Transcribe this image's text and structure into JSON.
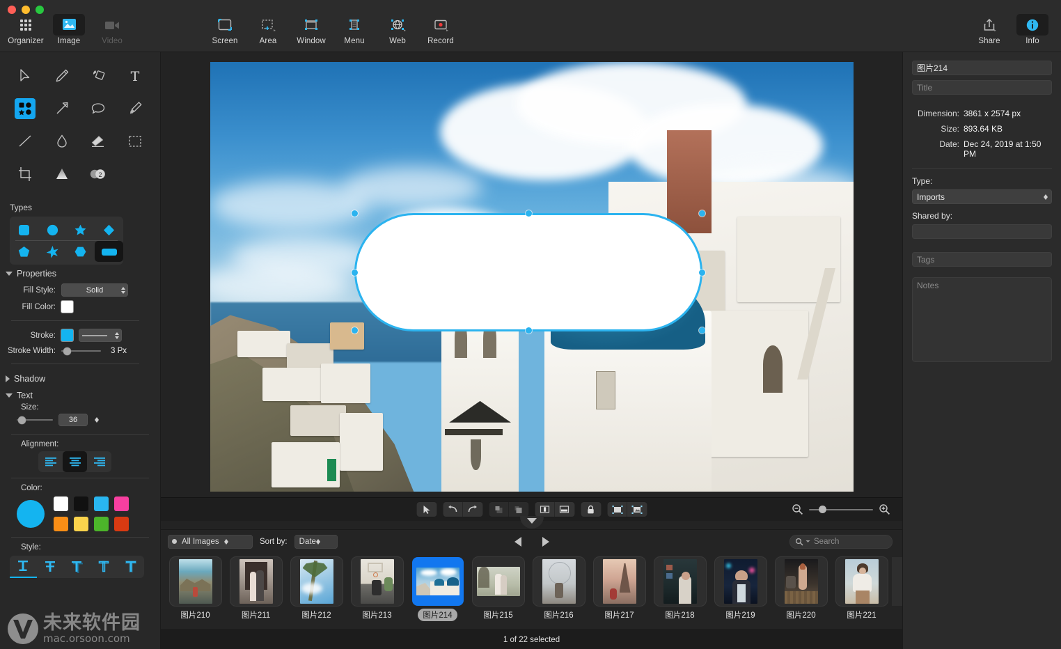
{
  "window": {
    "traffic_lights": [
      "close",
      "minimize",
      "zoom"
    ]
  },
  "toolbar": {
    "left_items": [
      {
        "label": "Organizer",
        "icon": "grid-icon",
        "active": false
      },
      {
        "label": "Image",
        "icon": "image-icon",
        "active": true
      },
      {
        "label": "Video",
        "icon": "video-icon",
        "active": false,
        "disabled": true
      }
    ],
    "capture_items": [
      {
        "label": "Screen",
        "icon": "screen-capture-icon"
      },
      {
        "label": "Area",
        "icon": "area-capture-icon"
      },
      {
        "label": "Window",
        "icon": "window-capture-icon"
      },
      {
        "label": "Menu",
        "icon": "menu-capture-icon"
      },
      {
        "label": "Web",
        "icon": "web-capture-icon"
      },
      {
        "label": "Record",
        "icon": "record-icon"
      }
    ],
    "right_items": [
      {
        "label": "Share",
        "icon": "share-icon",
        "active": false
      },
      {
        "label": "Info",
        "icon": "info-icon",
        "active": true
      }
    ]
  },
  "tools": {
    "rows": [
      [
        "select-arrow-icon",
        "pencil-icon",
        "shapes-fill-icon",
        "text-tool-icon"
      ],
      [
        "shapes-tool-icon",
        "arrow-tool-icon",
        "callout-bubble-icon",
        "marker-pen-icon"
      ],
      [
        "line-tool-icon",
        "blur-drop-icon",
        "eraser-icon",
        "marquee-select-icon"
      ],
      [
        "crop-icon",
        "spotlight-cone-icon",
        "step-number-icon"
      ]
    ],
    "active": "shapes-tool-icon",
    "step_number_badge": "2"
  },
  "shapes_panel": {
    "types_label": "Types",
    "types": [
      [
        "rounded-square-shape",
        "circle-shape",
        "star5-shape",
        "diamond-shape"
      ],
      [
        "pentagon-shape",
        "burst-star-shape",
        "hexagon-shape",
        "pill-shape"
      ]
    ],
    "selected_type": "pill-shape"
  },
  "properties": {
    "header": "Properties",
    "expanded": true,
    "fill_style_label": "Fill Style:",
    "fill_style_value": "Solid",
    "fill_color_label": "Fill Color:",
    "fill_color_value": "#ffffff",
    "stroke_label": "Stroke:",
    "stroke_color_value": "#14b4f0",
    "stroke_style_value": "solid-line",
    "stroke_width_label": "Stroke Width:",
    "stroke_width_value": "3 Px",
    "stroke_width_percent": 18
  },
  "shadow": {
    "header": "Shadow",
    "expanded": false
  },
  "text": {
    "header": "Text",
    "expanded": true,
    "size_label": "Size:",
    "size_value": "36",
    "size_percent": 14,
    "alignment_label": "Alignment:",
    "alignments": [
      "align-left-icon",
      "align-center-icon",
      "align-right-icon"
    ],
    "alignment_selected": "align-center-icon",
    "color_label": "Color:",
    "current_color": "#14b4f0",
    "palette": [
      "#ffffff",
      "#111111",
      "#29b6f0",
      "#f83fa0",
      "#f98e16",
      "#fbd34c",
      "#4cb52a",
      "#d93a12"
    ],
    "style_label": "Style:",
    "styles": [
      "text-style-plain-icon",
      "text-style-strikethrough-icon",
      "text-style-shadow-icon",
      "text-style-outline-icon",
      "text-style-glow-icon"
    ],
    "style_selected": "text-style-plain-icon"
  },
  "canvas": {
    "image_name": "图片214",
    "shape": {
      "type": "pill",
      "fill": "#ffffff",
      "stroke": "#2bb3ef",
      "stroke_width_px": 3,
      "handles": 8
    }
  },
  "canvas_tools": {
    "buttons": [
      {
        "name": "pointer-tool-button",
        "icon": "cursor-arrow-icon"
      },
      {
        "name": "undo-button",
        "icon": "undo-arrow-icon"
      },
      {
        "name": "redo-button",
        "icon": "redo-arrow-icon"
      },
      {
        "name": "bring-forward-button",
        "icon": "bring-forward-icon",
        "disabled": true
      },
      {
        "name": "send-backward-button",
        "icon": "send-backward-icon",
        "disabled": true
      },
      {
        "name": "compare-split-button",
        "icon": "split-view-icon"
      },
      {
        "name": "stack-view-button",
        "icon": "stack-view-icon"
      },
      {
        "name": "lock-button",
        "icon": "lock-icon"
      },
      {
        "name": "fit-to-window-button",
        "icon": "fit-window-icon"
      },
      {
        "name": "actual-size-button",
        "icon": "actual-size-icon"
      }
    ],
    "zoom_out_icon": "zoom-out-icon",
    "zoom_in_icon": "zoom-in-icon",
    "zoom_percent": 14
  },
  "browser_bar": {
    "filter_value": "All Images",
    "sort_label": "Sort by:",
    "sort_value": "Date",
    "prev_icon": "previous-arrow-icon",
    "next_icon": "next-arrow-icon",
    "search_placeholder": "Search",
    "search_value": ""
  },
  "thumbnails": {
    "items": [
      {
        "label": "图片210",
        "selected": false,
        "kind": "coast-rocks"
      },
      {
        "label": "图片211",
        "selected": false,
        "kind": "couple-doorway"
      },
      {
        "label": "图片212",
        "selected": false,
        "kind": "palm-sky"
      },
      {
        "label": "图片213",
        "selected": false,
        "kind": "basketball"
      },
      {
        "label": "图片214",
        "selected": true,
        "kind": "santorini"
      },
      {
        "label": "图片215",
        "selected": false,
        "kind": "couple-park"
      },
      {
        "label": "图片216",
        "selected": false,
        "kind": "london-eye"
      },
      {
        "label": "图片217",
        "selected": false,
        "kind": "eiffel"
      },
      {
        "label": "图片218",
        "selected": false,
        "kind": "girl-room"
      },
      {
        "label": "图片219",
        "selected": false,
        "kind": "neon-girl"
      },
      {
        "label": "图片220",
        "selected": false,
        "kind": "rooftop"
      },
      {
        "label": "图片221",
        "selected": false,
        "kind": "woman-portrait"
      },
      {
        "label": "",
        "selected": false,
        "kind": "partial"
      }
    ]
  },
  "status": {
    "text": "1 of 22 selected"
  },
  "info_panel": {
    "name_value": "图片214",
    "title_placeholder": "Title",
    "dimension_label": "Dimension:",
    "dimension_value": "3861 x 2574 px",
    "size_label": "Size:",
    "size_value": "893.64 KB",
    "date_label": "Date:",
    "date_value": "Dec 24, 2019 at 1:50 PM",
    "type_label": "Type:",
    "type_value": "Imports",
    "shared_by_label": "Shared by:",
    "shared_by_value": "",
    "tags_placeholder": "Tags",
    "notes_placeholder": "Notes"
  },
  "watermark": {
    "cn": "未来软件园",
    "url": "mac.orsoon.com"
  },
  "colors": {
    "accent": "#14b4f0",
    "selection": "#1277ef",
    "panel_bg": "#282828",
    "toolbar_bg": "#2c2c2c"
  }
}
